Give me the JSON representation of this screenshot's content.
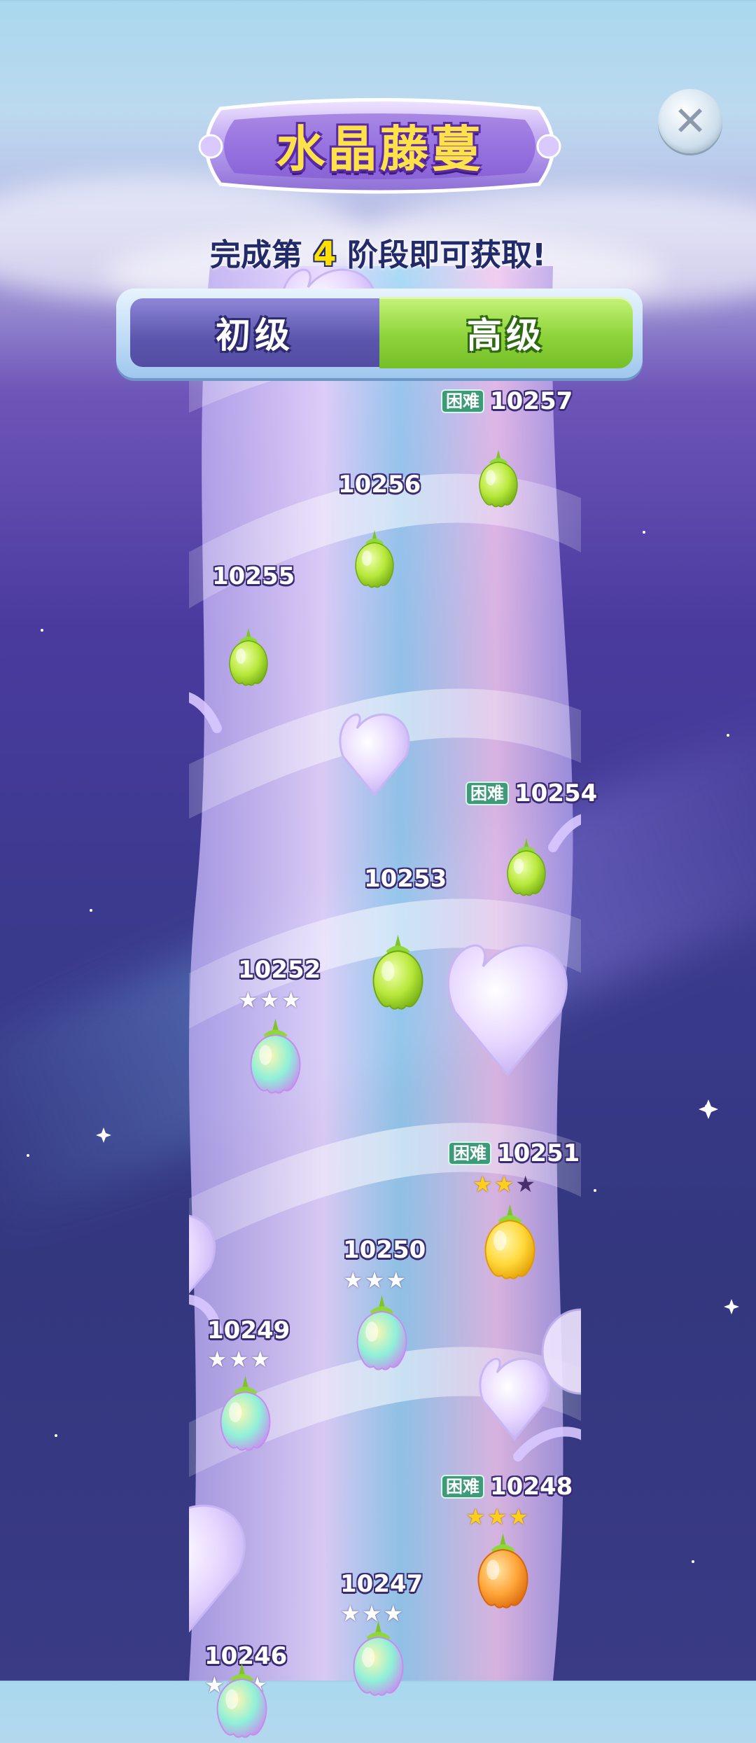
{
  "title": "水晶藤蔓",
  "subtitle": {
    "prefix": "完成第",
    "stage": "4",
    "suffix": "阶段即可获取!"
  },
  "tabs": {
    "basic": "初级",
    "advanced": "高级"
  },
  "selected_tab": "advanced",
  "hard_label": "困难",
  "levels": [
    {
      "id": "10257",
      "hard": true,
      "stars": 0,
      "fruit": "green"
    },
    {
      "id": "10256",
      "hard": false,
      "stars": 0,
      "fruit": "green"
    },
    {
      "id": "10255",
      "hard": false,
      "stars": 0,
      "fruit": "green"
    },
    {
      "id": "10254",
      "hard": true,
      "stars": 0,
      "fruit": "green"
    },
    {
      "id": "10253",
      "hard": false,
      "stars": 0,
      "fruit": "green",
      "current": true
    },
    {
      "id": "10252",
      "hard": false,
      "stars": 3,
      "star_type": "rainbow",
      "fruit": "rainbow"
    },
    {
      "id": "10251",
      "hard": true,
      "stars": 2,
      "star_type": "gold",
      "fruit": "yellow"
    },
    {
      "id": "10250",
      "hard": false,
      "stars": 3,
      "star_type": "rainbow",
      "fruit": "rainbow"
    },
    {
      "id": "10249",
      "hard": false,
      "stars": 3,
      "star_type": "rainbow",
      "fruit": "rainbow"
    },
    {
      "id": "10248",
      "hard": true,
      "stars": 3,
      "star_type": "gold",
      "fruit": "orange"
    },
    {
      "id": "10247",
      "hard": false,
      "stars": 3,
      "star_type": "rainbow",
      "fruit": "rainbow"
    },
    {
      "id": "10246",
      "hard": false,
      "stars": 3,
      "star_type": "rainbow",
      "fruit": "rainbow"
    }
  ],
  "colors": {
    "accent_green": "#8ed33a",
    "tab_purple": "#5b55ad",
    "hard_badge": "#3f9a7a",
    "gold_star": "#ffcf1a"
  }
}
